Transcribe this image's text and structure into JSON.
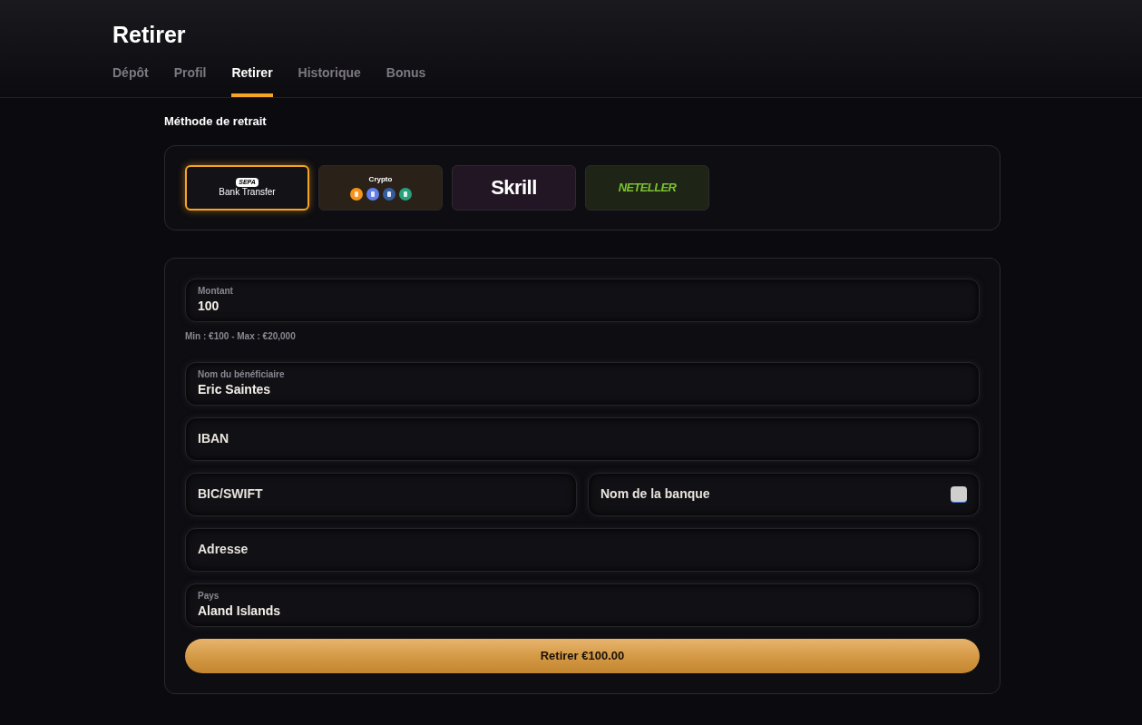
{
  "page": {
    "title": "Retirer"
  },
  "tabs": [
    {
      "label": "Dépôt",
      "selected": false
    },
    {
      "label": "Profil",
      "selected": false
    },
    {
      "label": "Retirer",
      "selected": true
    },
    {
      "label": "Historique",
      "selected": false
    },
    {
      "label": "Bonus",
      "selected": false
    }
  ],
  "method_section": {
    "heading": "Méthode de retrait",
    "methods": [
      {
        "kind": "sepa",
        "badge": "SEPA",
        "label": "Bank Transfer",
        "selected": true
      },
      {
        "kind": "crypto",
        "label": "Crypto",
        "selected": false
      },
      {
        "kind": "skrill",
        "label": "Skrill",
        "selected": false
      },
      {
        "kind": "neteller",
        "label": "NETELLER",
        "selected": false
      }
    ]
  },
  "form": {
    "rows": [
      [
        {
          "label": "Montant",
          "value": "100",
          "hint": "Min : €100 - Max : €20,000"
        }
      ],
      [
        {
          "label": "Nom du bénéficiaire",
          "value": "Eric Saintes"
        }
      ],
      [
        {
          "placeholder": "IBAN"
        }
      ],
      [
        {
          "placeholder": "BIC/SWIFT"
        },
        {
          "placeholder": "Nom de la banque",
          "autofill_icon": true
        }
      ],
      [
        {
          "placeholder": "Adresse"
        }
      ],
      [
        {
          "label": "Pays",
          "value": "Aland Islands"
        }
      ]
    ],
    "submit": "Retirer €100.00"
  }
}
